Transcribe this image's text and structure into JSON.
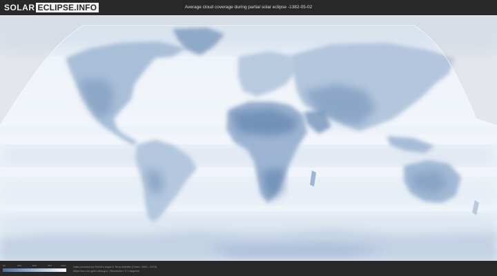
{
  "header": {
    "logo_solar": "SOLAR",
    "logo_eclipse": "ECLIPSE.INFO",
    "title": "Average cloud coverage during partial solar eclipse -1382-05-02"
  },
  "legend": {
    "ticks": [
      "0%",
      "25%",
      "50%",
      "75%",
      "100%"
    ],
    "colors": [
      "#4d6f97",
      "#7d9bc0",
      "#b6cbe2",
      "#ffffff"
    ]
  },
  "footer": {
    "credit_line_1": "Data provided by NASA's Aqua & Terra satellite (Years: 2003 - 2019)",
    "credit_line_2": "https://neo.sci.gsfc.nasa.gov | Resolution: 0.1 degrees"
  },
  "map": {
    "ocean_color": "#e9f0f7",
    "cloud_clear_color": "#6f8fb6",
    "eclipse_shade_color": "#d2d5da"
  }
}
